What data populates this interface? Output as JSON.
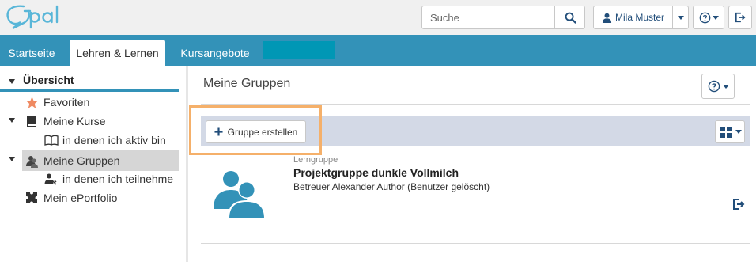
{
  "header": {
    "search": {
      "placeholder": "Suche",
      "value": ""
    },
    "user": {
      "name": "Mila Muster"
    }
  },
  "nav": {
    "tabs": [
      {
        "label": "Startseite",
        "active": false
      },
      {
        "label": "Lehren & Lernen",
        "active": true
      },
      {
        "label": "Kursangebote",
        "active": false
      }
    ]
  },
  "sidebar": {
    "overview_label": "Übersicht",
    "items": [
      {
        "label": "Favoriten",
        "icon": "star-icon"
      },
      {
        "label": "Meine Kurse",
        "icon": "book-icon"
      },
      {
        "label": "in denen ich aktiv bin",
        "icon": "open-book-icon"
      },
      {
        "label": "Meine Gruppen",
        "icon": "users-icon",
        "selected": true
      },
      {
        "label": "in denen ich teilnehme",
        "icon": "user-icon"
      },
      {
        "label": "Mein ePortfolio",
        "icon": "puzzle-icon"
      }
    ]
  },
  "main": {
    "title": "Meine Gruppen",
    "create_button": "Gruppe erstellen",
    "groups": [
      {
        "type": "Lerngruppe",
        "name": "Projektgruppe dunkle Vollmilch",
        "tutor": "Betreuer Alexander Author (Benutzer gelöscht)"
      }
    ]
  },
  "colors": {
    "nav": "#3392b8",
    "highlight": "#f5b06a",
    "toolbar": "#d3d9e6",
    "icon_blue": "#3392b8"
  }
}
